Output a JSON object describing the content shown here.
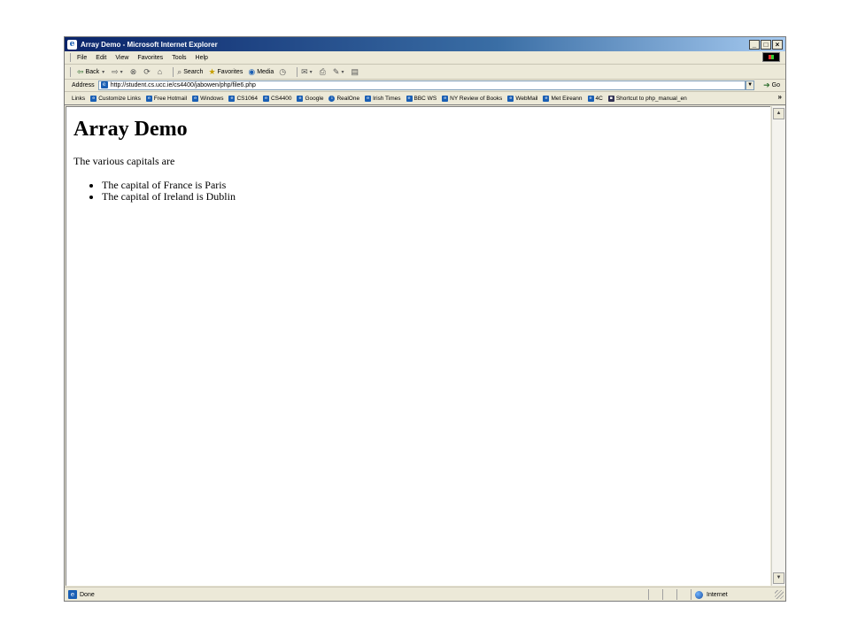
{
  "window": {
    "title": "Array Demo - Microsoft Internet Explorer"
  },
  "menubar": {
    "items": [
      {
        "label": "File",
        "mnemonic": "F"
      },
      {
        "label": "Edit",
        "mnemonic": "E"
      },
      {
        "label": "View",
        "mnemonic": "V"
      },
      {
        "label": "Favorites",
        "mnemonic": "a"
      },
      {
        "label": "Tools",
        "mnemonic": "T"
      },
      {
        "label": "Help",
        "mnemonic": "H"
      }
    ]
  },
  "toolbar": {
    "back_label": "Back",
    "search_label": "Search",
    "favorites_label": "Favorites",
    "media_label": "Media"
  },
  "addressbar": {
    "label": "Address",
    "url": "http://student.cs.ucc.ie/cs4400/jabowen/php/file6.php",
    "go_label": "Go"
  },
  "linksbar": {
    "label": "Links",
    "items": [
      "Customize Links",
      "Free Hotmail",
      "Windows",
      "CS1064",
      "CS4400",
      "Google",
      "RealOne",
      "Irish Times",
      "BBC WS",
      "NY Review of Books",
      "WebMail",
      "Met Eireann",
      "4C",
      "Shortcut to php_manual_en"
    ]
  },
  "page": {
    "heading": "Array Demo",
    "intro": "The various capitals are",
    "items": [
      "The capital of France is Paris",
      "The capital of Ireland is Dublin"
    ]
  },
  "statusbar": {
    "status": "Done",
    "zone": "Internet"
  },
  "colors": {
    "titlebar_start": "#0a246a",
    "titlebar_end": "#a6caf0",
    "chrome": "#ece9d8"
  }
}
